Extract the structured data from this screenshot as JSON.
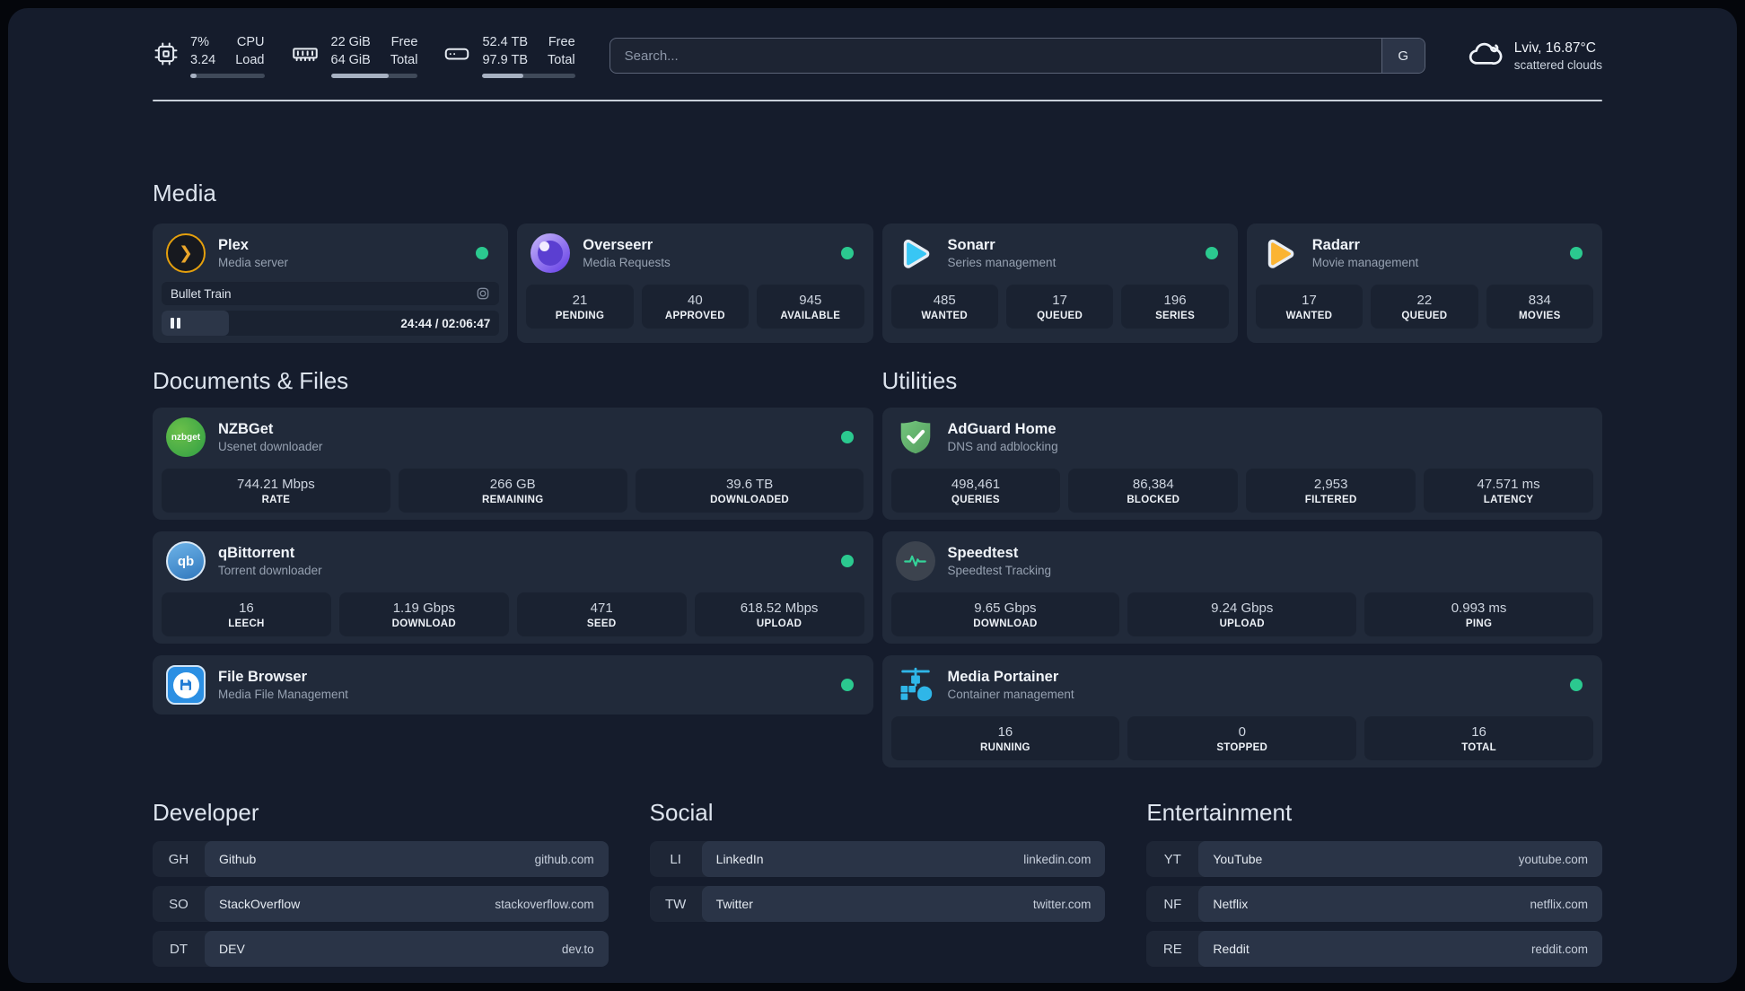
{
  "header": {
    "system_stats": [
      {
        "name": "cpu",
        "values": [
          "7%",
          "3.24"
        ],
        "labels": [
          "CPU",
          "Load"
        ],
        "progress_pct": 8
      },
      {
        "name": "memory",
        "values": [
          "22 GiB",
          "64 GiB"
        ],
        "labels": [
          "Free",
          "Total"
        ],
        "progress_pct": 66
      },
      {
        "name": "disk",
        "values": [
          "52.4 TB",
          "97.9 TB"
        ],
        "labels": [
          "Free",
          "Total"
        ],
        "progress_pct": 44
      }
    ],
    "search": {
      "placeholder": "Search...",
      "engine_button": "G"
    },
    "weather": {
      "location_temp": "Lviv, 16.87°C",
      "condition": "scattered clouds"
    }
  },
  "sections": {
    "media": {
      "title": "Media",
      "plex": {
        "name": "Plex",
        "desc": "Media server",
        "online": true,
        "now_playing": {
          "title": "Bullet Train",
          "time": "24:44 / 02:06:47",
          "progress_pct": 20
        }
      },
      "overseerr": {
        "name": "Overseerr",
        "desc": "Media Requests",
        "online": true,
        "stats": [
          {
            "value": "21",
            "label": "PENDING"
          },
          {
            "value": "40",
            "label": "APPROVED"
          },
          {
            "value": "945",
            "label": "AVAILABLE"
          }
        ]
      },
      "sonarr": {
        "name": "Sonarr",
        "desc": "Series management",
        "online": true,
        "stats": [
          {
            "value": "485",
            "label": "WANTED"
          },
          {
            "value": "17",
            "label": "QUEUED"
          },
          {
            "value": "196",
            "label": "SERIES"
          }
        ]
      },
      "radarr": {
        "name": "Radarr",
        "desc": "Movie management",
        "online": true,
        "stats": [
          {
            "value": "17",
            "label": "WANTED"
          },
          {
            "value": "22",
            "label": "QUEUED"
          },
          {
            "value": "834",
            "label": "MOVIES"
          }
        ]
      }
    },
    "documents": {
      "title": "Documents & Files",
      "nzbget": {
        "name": "NZBGet",
        "desc": "Usenet downloader",
        "online": true,
        "icon_text": "nzbget",
        "stats": [
          {
            "value": "744.21 Mbps",
            "label": "RATE"
          },
          {
            "value": "266 GB",
            "label": "REMAINING"
          },
          {
            "value": "39.6 TB",
            "label": "DOWNLOADED"
          }
        ]
      },
      "qbittorrent": {
        "name": "qBittorrent",
        "desc": "Torrent downloader",
        "online": true,
        "icon_text": "qb",
        "stats": [
          {
            "value": "16",
            "label": "LEECH"
          },
          {
            "value": "1.19 Gbps",
            "label": "DOWNLOAD"
          },
          {
            "value": "471",
            "label": "SEED"
          },
          {
            "value": "618.52 Mbps",
            "label": "UPLOAD"
          }
        ]
      },
      "filebrowser": {
        "name": "File Browser",
        "desc": "Media File Management",
        "online": true
      }
    },
    "utilities": {
      "title": "Utilities",
      "adguard": {
        "name": "AdGuard Home",
        "desc": "DNS and adblocking",
        "online": false,
        "stats": [
          {
            "value": "498,461",
            "label": "QUERIES"
          },
          {
            "value": "86,384",
            "label": "BLOCKED"
          },
          {
            "value": "2,953",
            "label": "FILTERED"
          },
          {
            "value": "47.571 ms",
            "label": "LATENCY"
          }
        ]
      },
      "speedtest": {
        "name": "Speedtest",
        "desc": "Speedtest Tracking",
        "online": false,
        "stats": [
          {
            "value": "9.65 Gbps",
            "label": "DOWNLOAD"
          },
          {
            "value": "9.24 Gbps",
            "label": "UPLOAD"
          },
          {
            "value": "0.993 ms",
            "label": "PING"
          }
        ]
      },
      "portainer": {
        "name": "Media Portainer",
        "desc": "Container management",
        "online": true,
        "stats": [
          {
            "value": "16",
            "label": "RUNNING"
          },
          {
            "value": "0",
            "label": "STOPPED"
          },
          {
            "value": "16",
            "label": "TOTAL"
          }
        ]
      }
    }
  },
  "bookmarks": [
    {
      "title": "Developer",
      "items": [
        {
          "abbr": "GH",
          "name": "Github",
          "url": "github.com"
        },
        {
          "abbr": "SO",
          "name": "StackOverflow",
          "url": "stackoverflow.com"
        },
        {
          "abbr": "DT",
          "name": "DEV",
          "url": "dev.to"
        }
      ]
    },
    {
      "title": "Social",
      "items": [
        {
          "abbr": "LI",
          "name": "LinkedIn",
          "url": "linkedin.com"
        },
        {
          "abbr": "TW",
          "name": "Twitter",
          "url": "twitter.com"
        }
      ]
    },
    {
      "title": "Entertainment",
      "items": [
        {
          "abbr": "YT",
          "name": "YouTube",
          "url": "youtube.com"
        },
        {
          "abbr": "NF",
          "name": "Netflix",
          "url": "netflix.com"
        },
        {
          "abbr": "RE",
          "name": "Reddit",
          "url": "reddit.com"
        }
      ]
    }
  ],
  "colors": {
    "status_online": "#2bc98f",
    "accent_pulse": "#34d399",
    "card_bg": "#212a3a",
    "page_bg": "#151c2c"
  }
}
